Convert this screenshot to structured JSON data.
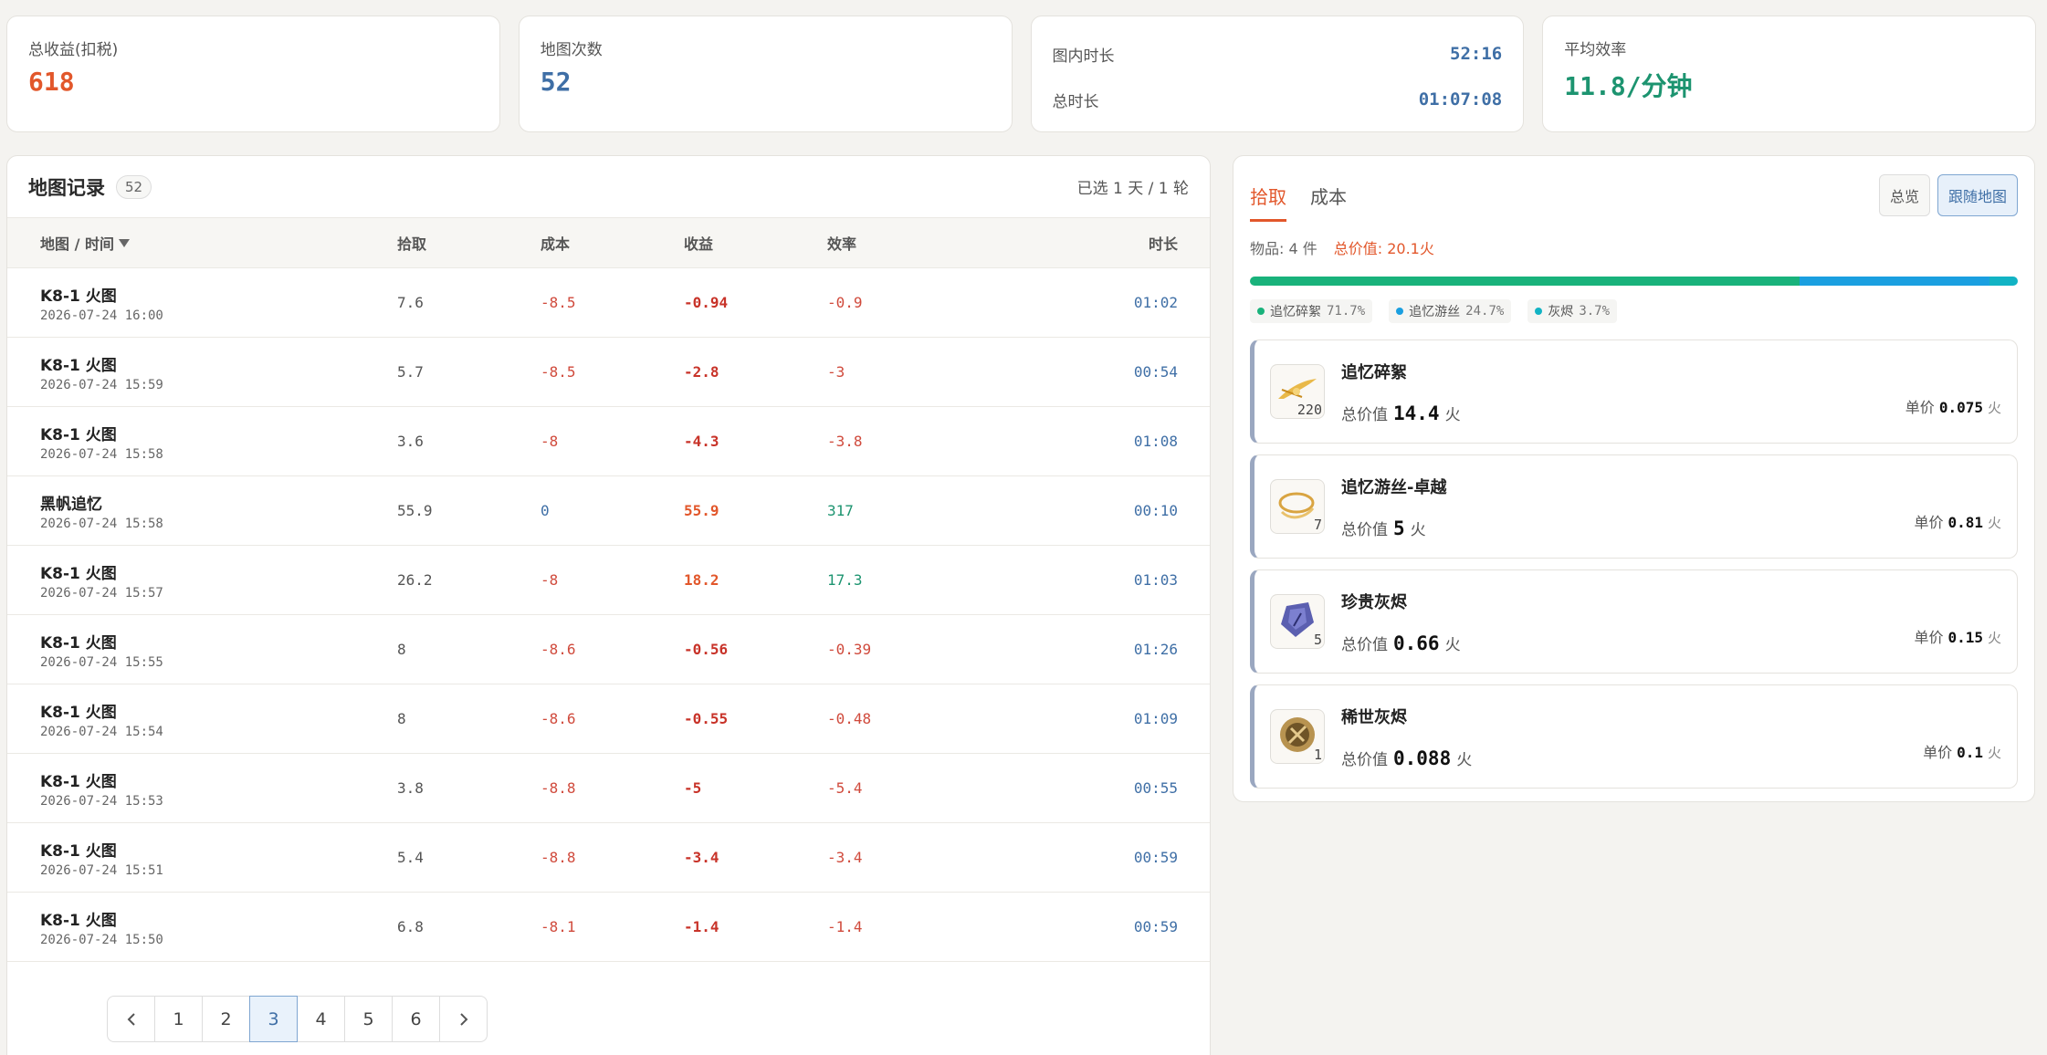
{
  "stats": {
    "total_income_label": "总收益(扣税)",
    "total_income_value": "618",
    "map_count_label": "地图次数",
    "map_count_value": "52",
    "in_map_time_label": "图内时长",
    "in_map_time_value": "52:16",
    "total_time_label": "总时长",
    "total_time_value": "01:07:08",
    "avg_eff_label": "平均效率",
    "avg_eff_value": "11.8/分钟"
  },
  "records": {
    "title": "地图记录",
    "count": "52",
    "selected": "已选 1 天 / 1 轮",
    "columns": {
      "map": "地图 / 时间",
      "pick": "拾取",
      "cost": "成本",
      "profit": "收益",
      "eff": "效率",
      "time": "时长"
    },
    "rows": [
      {
        "map": "K8-1 火图",
        "date": "2026-07-24 16:00",
        "pick": "7.6",
        "cost": "-8.5",
        "profit": "-0.94",
        "eff": "-0.9",
        "time": "01:02"
      },
      {
        "map": "K8-1 火图",
        "date": "2026-07-24 15:59",
        "pick": "5.7",
        "cost": "-8.5",
        "profit": "-2.8",
        "eff": "-3",
        "time": "00:54"
      },
      {
        "map": "K8-1 火图",
        "date": "2026-07-24 15:58",
        "pick": "3.6",
        "cost": "-8",
        "profit": "-4.3",
        "eff": "-3.8",
        "time": "01:08"
      },
      {
        "map": "黑帆追忆",
        "date": "2026-07-24 15:58",
        "pick": "55.9",
        "cost": "0",
        "profit": "55.9",
        "eff": "317",
        "time": "00:10"
      },
      {
        "map": "K8-1 火图",
        "date": "2026-07-24 15:57",
        "pick": "26.2",
        "cost": "-8",
        "profit": "18.2",
        "eff": "17.3",
        "time": "01:03"
      },
      {
        "map": "K8-1 火图",
        "date": "2026-07-24 15:55",
        "pick": "8",
        "cost": "-8.6",
        "profit": "-0.56",
        "eff": "-0.39",
        "time": "01:26"
      },
      {
        "map": "K8-1 火图",
        "date": "2026-07-24 15:54",
        "pick": "8",
        "cost": "-8.6",
        "profit": "-0.55",
        "eff": "-0.48",
        "time": "01:09"
      },
      {
        "map": "K8-1 火图",
        "date": "2026-07-24 15:53",
        "pick": "3.8",
        "cost": "-8.8",
        "profit": "-5",
        "eff": "-5.4",
        "time": "00:55"
      },
      {
        "map": "K8-1 火图",
        "date": "2026-07-24 15:51",
        "pick": "5.4",
        "cost": "-8.8",
        "profit": "-3.4",
        "eff": "-3.4",
        "time": "00:59"
      },
      {
        "map": "K8-1 火图",
        "date": "2026-07-24 15:50",
        "pick": "6.8",
        "cost": "-8.1",
        "profit": "-1.4",
        "eff": "-1.4",
        "time": "00:59"
      }
    ],
    "pages": [
      "1",
      "2",
      "3",
      "4",
      "5",
      "6"
    ],
    "current_page": "3"
  },
  "items_panel": {
    "tabs": [
      "拾取",
      "成本"
    ],
    "active_tab": "拾取",
    "overview_btn": "总览",
    "follow_btn": "跟随地图",
    "summary_count": "物品: 4 件",
    "summary_total": "总价值: 20.1火",
    "composition": [
      {
        "name": "追忆碎絮",
        "pct": "71.7%",
        "share": 71.7,
        "color": "#19b27b"
      },
      {
        "name": "追忆游丝",
        "pct": "24.7%",
        "share": 24.7,
        "color": "#1a9fe0"
      },
      {
        "name": "灰烬",
        "pct": "3.7%",
        "share": 3.7,
        "color": "#12b3c4"
      }
    ],
    "total_label": "总价值",
    "unit_label": "单价",
    "currency": "火",
    "items": [
      {
        "name": "追忆碎絮",
        "qty": "220",
        "total": "14.4",
        "unit": "0.075",
        "icon": "feather-icon"
      },
      {
        "name": "追忆游丝-卓越",
        "qty": "7",
        "total": "5",
        "unit": "0.81",
        "icon": "thread-icon"
      },
      {
        "name": "珍贵灰烬",
        "qty": "5",
        "total": "0.66",
        "unit": "0.15",
        "icon": "crystal-icon"
      },
      {
        "name": "稀世灰烬",
        "qty": "1",
        "total": "0.088",
        "unit": "0.1",
        "icon": "emblem-icon"
      }
    ]
  }
}
